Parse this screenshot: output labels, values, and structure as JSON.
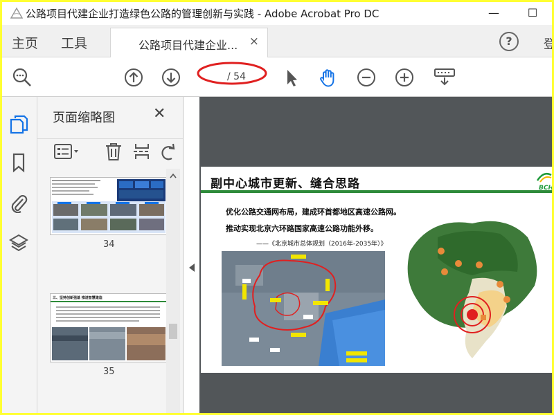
{
  "window": {
    "title": "公路项目代建企业打造绿色公路的管理创新与实践 - Adobe Acrobat Pro DC",
    "minimize": "—",
    "maximize": "☐"
  },
  "tabs": {
    "home": "主页",
    "tools": "工具",
    "document": "公路项目代建企业...",
    "close": "×",
    "help": "?",
    "login": "登"
  },
  "toolbar": {
    "page_current": "",
    "page_total": "/ 54",
    "icons": [
      "search-zoom-icon",
      "page-up-icon",
      "page-down-icon",
      "select-cursor-icon",
      "hand-tool-icon",
      "zoom-out-icon",
      "zoom-in-icon",
      "keyboard-dropdown-icon"
    ]
  },
  "sidebar": {
    "icons": [
      "page-thumbnails-icon",
      "bookmark-icon",
      "attachment-icon",
      "layers-icon"
    ]
  },
  "thumbnail_panel": {
    "title": "页面缩略图",
    "close": "✕",
    "thumbs": [
      {
        "page": "34"
      },
      {
        "page": "35",
        "heading": "三、坚持创新强基  推进智慧建造"
      }
    ]
  },
  "document": {
    "slide_title": "副中心城市更新、缝合思路",
    "line1": "优化公路交通网布局，建成环首都地区高速公路网。",
    "line2": "推动实现北京六环路国家高速公路功能外移。",
    "source": "——《北京城市总体规划（2016年-2035年）》",
    "logo": "BCH"
  },
  "colors": {
    "frame": "#ffff33",
    "accent_blue": "#1473e6",
    "annotation_red": "#e02020",
    "slide_green": "#2e8b3a"
  }
}
